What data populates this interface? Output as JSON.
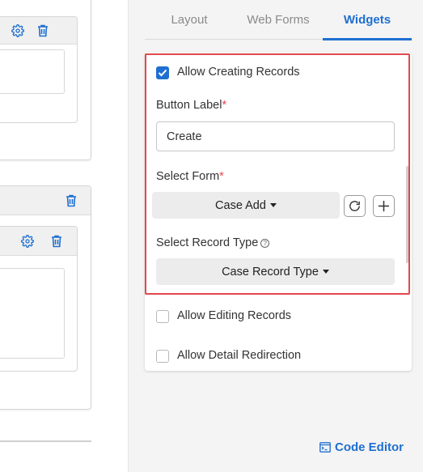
{
  "tabs": [
    {
      "label": "Layout"
    },
    {
      "label": "Web Forms"
    },
    {
      "label": "Widgets"
    }
  ],
  "allow_creating": {
    "label": "Allow Creating Records",
    "checked": true
  },
  "button_label": {
    "label": "Button Label",
    "required_mark": "*",
    "value": "Create"
  },
  "select_form": {
    "label": "Select Form",
    "required_mark": "*",
    "selected": "Case Add"
  },
  "select_record_type": {
    "label": "Select Record Type",
    "help": "?",
    "selected": "Case Record Type"
  },
  "allow_editing": {
    "label": "Allow Editing Records",
    "checked": false
  },
  "allow_detail": {
    "label": "Allow Detail Redirection",
    "checked": false
  },
  "code_editor": {
    "label": "Code Editor"
  },
  "colors": {
    "accent": "#1f6fd1",
    "highlight": "#e4464e",
    "required": "#e4464e"
  }
}
